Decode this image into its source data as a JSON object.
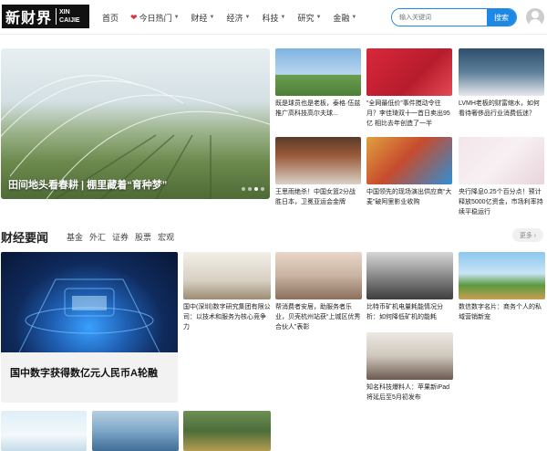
{
  "logo": {
    "cn": "新财界",
    "en_line1": "XIN",
    "en_line2": "CAIJIE"
  },
  "nav": [
    {
      "label": "首页",
      "dropdown": false,
      "icon": ""
    },
    {
      "label": "今日热门",
      "dropdown": true,
      "icon": "heart-icon"
    },
    {
      "label": "财经",
      "dropdown": true,
      "icon": ""
    },
    {
      "label": "经济",
      "dropdown": true,
      "icon": ""
    },
    {
      "label": "科技",
      "dropdown": true,
      "icon": ""
    },
    {
      "label": "研究",
      "dropdown": true,
      "icon": ""
    },
    {
      "label": "金融",
      "dropdown": true,
      "icon": ""
    }
  ],
  "search": {
    "placeholder": "输入关键词",
    "button": "搜索"
  },
  "hero": {
    "caption": "田间地头看春耕 | 棚里藏着“育种梦”",
    "slides": 4,
    "active_slide": 3
  },
  "top_news": [
    "既是球员也是老板，泰格·伍兹推广高科技高尔夫球...",
    "“全网最低价”事件搅动令往月？李佳琦双十一首日卖出95亿 相比去年创造了一半",
    "LVMH老板的财富缩水，如何看待奢侈品行业消费低迷？",
    "王思雨绝杀！中国女篮2分战胜日本，卫冕亚运会金牌",
    "中国领先的现场演出供应商“大麦”破阿里影业收购",
    "央行降息0.25个百分点！预计释放5000亿资金，市场利率持续平稳运行"
  ],
  "section": {
    "title": "财经要闻",
    "tabs": [
      "基金",
      "外汇",
      "证券",
      "股票",
      "宏观"
    ],
    "more": "更多 ›"
  },
  "feature": {
    "title": "国中数字获得数亿元人民币A轮融"
  },
  "finance_news": [
    "国中(深圳)数字研究集团有限公司：以技术和服务为核心竞争力",
    "帮消费者安居，助服务者乐业，贝壳杭州站获“上城区优秀合伙人”表彰",
    "比特币矿机电量耗能情况分析：如何降低矿机的能耗",
    "数信数字名片：商务个人的私域营销新宠",
    "知名科技爆料人：苹果新iPad将延后至5月初发布"
  ]
}
